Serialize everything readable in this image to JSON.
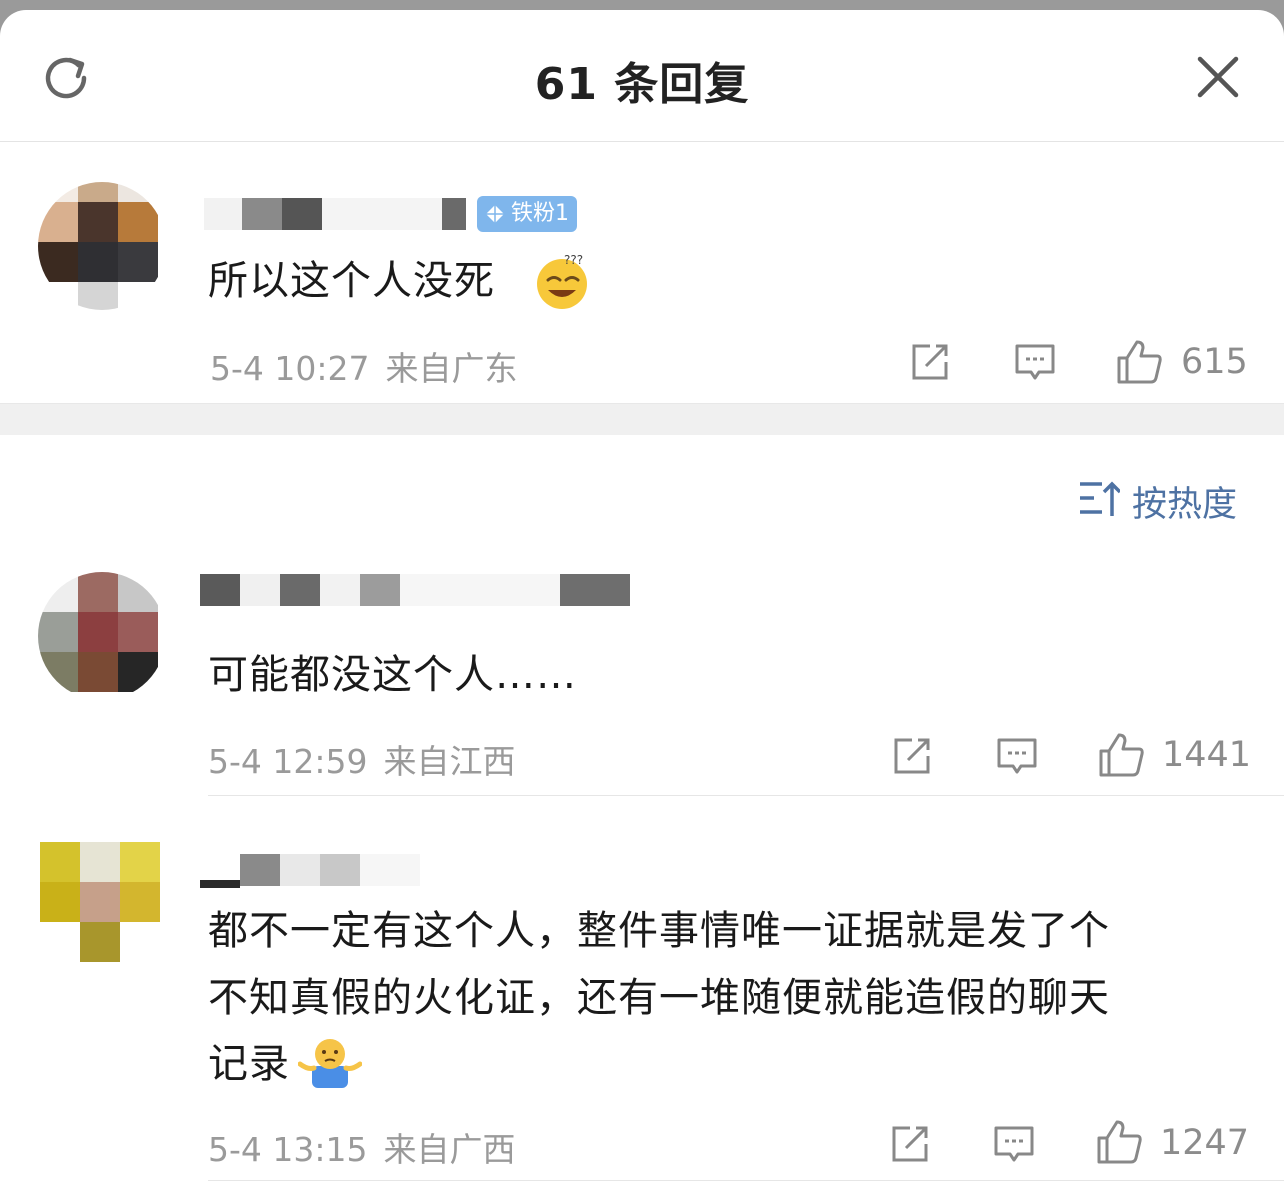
{
  "header": {
    "title": "61 条回复",
    "refresh_icon": "refresh-icon",
    "close_icon": "close-icon"
  },
  "main_comment": {
    "badge": "铁粉1",
    "text": "所以这个人没死",
    "emoji": "dizzy-grin-emoji",
    "time": "5-4 10:27",
    "location": "来自广东",
    "likes": "615"
  },
  "sort": {
    "label": "按热度",
    "icon": "sort-icon"
  },
  "replies": [
    {
      "text": "可能都没这个人……",
      "time": "5-4 12:59",
      "location": "来自江西",
      "likes": "1441"
    },
    {
      "text_line1": "都不一定有这个人，整件事情唯一证据就是发了个",
      "text_line2": "不知真假的火化证，还有一堆随便就能造假的聊天",
      "text_line3": "记录",
      "emoji": "shrug-emoji",
      "time": "5-4 13:15",
      "location": "来自广西",
      "likes": "1247"
    }
  ],
  "colors": {
    "accent": "#4e72a3",
    "badge": "#7fb6ec",
    "meta": "#9a9a9a",
    "text": "#1a1a1a"
  }
}
